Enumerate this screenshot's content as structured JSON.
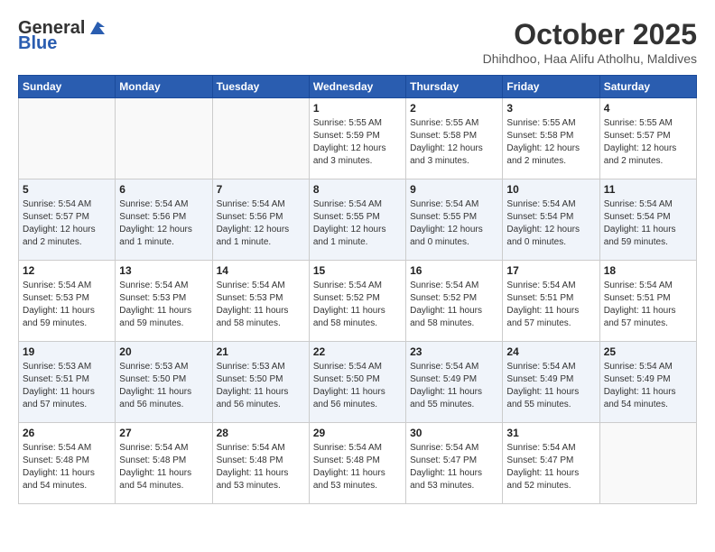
{
  "header": {
    "logo_general": "General",
    "logo_blue": "Blue",
    "month": "October 2025",
    "location": "Dhihdhoo, Haa Alifu Atholhu, Maldives"
  },
  "days_of_week": [
    "Sunday",
    "Monday",
    "Tuesday",
    "Wednesday",
    "Thursday",
    "Friday",
    "Saturday"
  ],
  "weeks": [
    [
      {
        "day": "",
        "info": ""
      },
      {
        "day": "",
        "info": ""
      },
      {
        "day": "",
        "info": ""
      },
      {
        "day": "1",
        "info": "Sunrise: 5:55 AM\nSunset: 5:59 PM\nDaylight: 12 hours\nand 3 minutes."
      },
      {
        "day": "2",
        "info": "Sunrise: 5:55 AM\nSunset: 5:58 PM\nDaylight: 12 hours\nand 3 minutes."
      },
      {
        "day": "3",
        "info": "Sunrise: 5:55 AM\nSunset: 5:58 PM\nDaylight: 12 hours\nand 2 minutes."
      },
      {
        "day": "4",
        "info": "Sunrise: 5:55 AM\nSunset: 5:57 PM\nDaylight: 12 hours\nand 2 minutes."
      }
    ],
    [
      {
        "day": "5",
        "info": "Sunrise: 5:54 AM\nSunset: 5:57 PM\nDaylight: 12 hours\nand 2 minutes."
      },
      {
        "day": "6",
        "info": "Sunrise: 5:54 AM\nSunset: 5:56 PM\nDaylight: 12 hours\nand 1 minute."
      },
      {
        "day": "7",
        "info": "Sunrise: 5:54 AM\nSunset: 5:56 PM\nDaylight: 12 hours\nand 1 minute."
      },
      {
        "day": "8",
        "info": "Sunrise: 5:54 AM\nSunset: 5:55 PM\nDaylight: 12 hours\nand 1 minute."
      },
      {
        "day": "9",
        "info": "Sunrise: 5:54 AM\nSunset: 5:55 PM\nDaylight: 12 hours\nand 0 minutes."
      },
      {
        "day": "10",
        "info": "Sunrise: 5:54 AM\nSunset: 5:54 PM\nDaylight: 12 hours\nand 0 minutes."
      },
      {
        "day": "11",
        "info": "Sunrise: 5:54 AM\nSunset: 5:54 PM\nDaylight: 11 hours\nand 59 minutes."
      }
    ],
    [
      {
        "day": "12",
        "info": "Sunrise: 5:54 AM\nSunset: 5:53 PM\nDaylight: 11 hours\nand 59 minutes."
      },
      {
        "day": "13",
        "info": "Sunrise: 5:54 AM\nSunset: 5:53 PM\nDaylight: 11 hours\nand 59 minutes."
      },
      {
        "day": "14",
        "info": "Sunrise: 5:54 AM\nSunset: 5:53 PM\nDaylight: 11 hours\nand 58 minutes."
      },
      {
        "day": "15",
        "info": "Sunrise: 5:54 AM\nSunset: 5:52 PM\nDaylight: 11 hours\nand 58 minutes."
      },
      {
        "day": "16",
        "info": "Sunrise: 5:54 AM\nSunset: 5:52 PM\nDaylight: 11 hours\nand 58 minutes."
      },
      {
        "day": "17",
        "info": "Sunrise: 5:54 AM\nSunset: 5:51 PM\nDaylight: 11 hours\nand 57 minutes."
      },
      {
        "day": "18",
        "info": "Sunrise: 5:54 AM\nSunset: 5:51 PM\nDaylight: 11 hours\nand 57 minutes."
      }
    ],
    [
      {
        "day": "19",
        "info": "Sunrise: 5:53 AM\nSunset: 5:51 PM\nDaylight: 11 hours\nand 57 minutes."
      },
      {
        "day": "20",
        "info": "Sunrise: 5:53 AM\nSunset: 5:50 PM\nDaylight: 11 hours\nand 56 minutes."
      },
      {
        "day": "21",
        "info": "Sunrise: 5:53 AM\nSunset: 5:50 PM\nDaylight: 11 hours\nand 56 minutes."
      },
      {
        "day": "22",
        "info": "Sunrise: 5:54 AM\nSunset: 5:50 PM\nDaylight: 11 hours\nand 56 minutes."
      },
      {
        "day": "23",
        "info": "Sunrise: 5:54 AM\nSunset: 5:49 PM\nDaylight: 11 hours\nand 55 minutes."
      },
      {
        "day": "24",
        "info": "Sunrise: 5:54 AM\nSunset: 5:49 PM\nDaylight: 11 hours\nand 55 minutes."
      },
      {
        "day": "25",
        "info": "Sunrise: 5:54 AM\nSunset: 5:49 PM\nDaylight: 11 hours\nand 54 minutes."
      }
    ],
    [
      {
        "day": "26",
        "info": "Sunrise: 5:54 AM\nSunset: 5:48 PM\nDaylight: 11 hours\nand 54 minutes."
      },
      {
        "day": "27",
        "info": "Sunrise: 5:54 AM\nSunset: 5:48 PM\nDaylight: 11 hours\nand 54 minutes."
      },
      {
        "day": "28",
        "info": "Sunrise: 5:54 AM\nSunset: 5:48 PM\nDaylight: 11 hours\nand 53 minutes."
      },
      {
        "day": "29",
        "info": "Sunrise: 5:54 AM\nSunset: 5:48 PM\nDaylight: 11 hours\nand 53 minutes."
      },
      {
        "day": "30",
        "info": "Sunrise: 5:54 AM\nSunset: 5:47 PM\nDaylight: 11 hours\nand 53 minutes."
      },
      {
        "day": "31",
        "info": "Sunrise: 5:54 AM\nSunset: 5:47 PM\nDaylight: 11 hours\nand 52 minutes."
      },
      {
        "day": "",
        "info": ""
      }
    ]
  ]
}
